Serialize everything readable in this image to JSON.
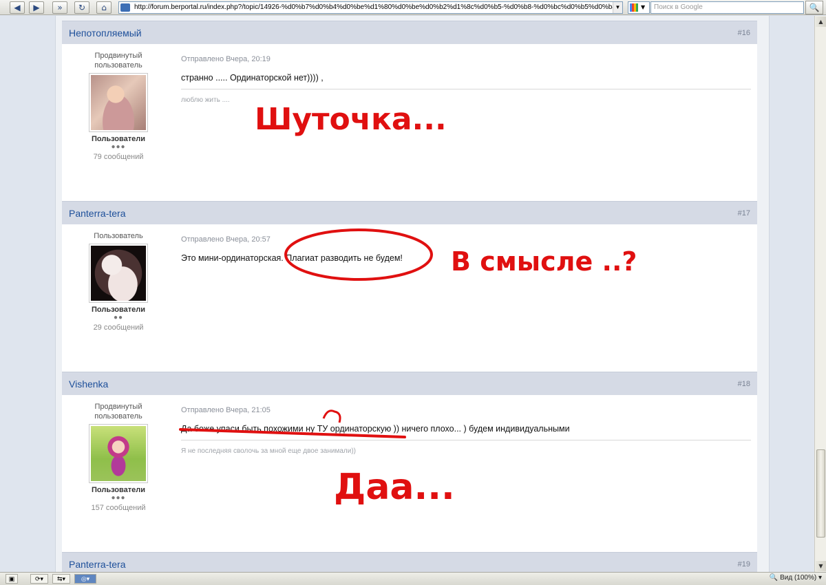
{
  "browser": {
    "url": "http://forum.berportal.ru/index.php?/topic/14926-%d0%b7%d0%b4%d0%be%d1%80%d0%be%d0%b2%d1%8c%d0%b5-%d0%b8-%d0%bc%d0%b5%d0%b4%d0",
    "search_placeholder": "Поиск в Google",
    "zoom_label": "Вид (100%)"
  },
  "posts": [
    {
      "author": "Непотопляемый",
      "number": "#16",
      "rank": "Продвинутый пользователь",
      "group": "Пользователи",
      "pips": "●●●",
      "count": "79 сообщений",
      "date": "Отправлено Вчера, 20:19",
      "text": "странно ..... Ординаторской нет)))) ,",
      "signature": "люблю жить ...."
    },
    {
      "author": "Panterra-tera",
      "number": "#17",
      "rank": "Пользователь",
      "group": "Пользователи",
      "pips": "●●",
      "count": "29 сообщений",
      "date": "Отправлено Вчера, 20:57",
      "text": "Это мини-ординаторская. Плагиат разводить не будем!",
      "signature": ""
    },
    {
      "author": "Vishenka",
      "number": "#18",
      "rank": "Продвинутый пользователь",
      "group": "Пользователи",
      "pips": "●●●",
      "count": "157 сообщений",
      "date": "Отправлено Вчера, 21:05",
      "text": "Да боже упаси быть похожими ну ТУ ординаторскую )) ничего плохо... ) будем индивидуальными",
      "signature": "Я не последняя сволочь за мной еще двое занимали))"
    },
    {
      "author": "Panterra-tera",
      "number": "#19"
    }
  ],
  "annotations": {
    "joke": "Шуточка...",
    "meaning": "В смысле ..?",
    "yes": "Даа..."
  },
  "colors": {
    "annotation": "#e01010",
    "author_link": "#1d4f9a",
    "post_header": "#d5dae5"
  }
}
